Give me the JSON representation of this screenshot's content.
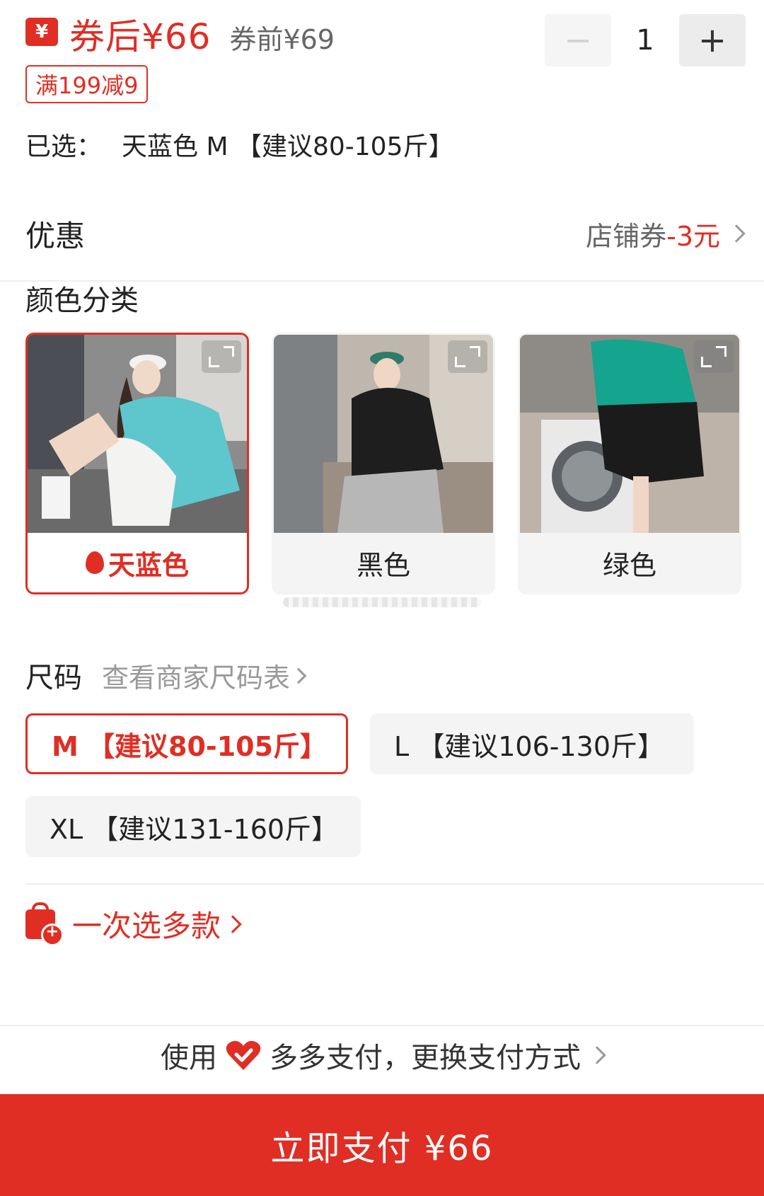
{
  "header": {
    "after_coupon_price": "券后¥66",
    "before_coupon_price": "券前¥69",
    "promo_tag": "满199减9",
    "quantity": "1"
  },
  "selected": {
    "label": "已选：",
    "value": "天蓝色 M 【建议80-105斤】"
  },
  "discount": {
    "title": "优惠",
    "prefix": "店铺券",
    "amount": "-3元"
  },
  "colors": {
    "title": "颜色分类",
    "items": [
      {
        "label": "天蓝色",
        "selected": true,
        "shirt": "#5ec6cd",
        "bottom": "#f3f3f1"
      },
      {
        "label": "黑色",
        "selected": false,
        "shirt": "#1e1e1e",
        "bottom": "#b7b7b7"
      },
      {
        "label": "绿色",
        "selected": false,
        "shirt": "#15a48e",
        "bottom": "#1b1b1b"
      }
    ]
  },
  "size": {
    "title": "尺码",
    "chart_link": "查看商家尺码表",
    "options": [
      {
        "label": "M 【建议80-105斤】",
        "selected": true
      },
      {
        "label": "L 【建议106-130斤】",
        "selected": false
      },
      {
        "label": "XL 【建议131-160斤】",
        "selected": false
      }
    ]
  },
  "multi_select": "一次选多款",
  "payment": {
    "use": "使用",
    "method_text": "多多支付，更换支付方式",
    "button": "立即支付 ¥66"
  },
  "colors_theme": {
    "accent": "#e02e24",
    "muted_bg": "#f4f4f4"
  }
}
